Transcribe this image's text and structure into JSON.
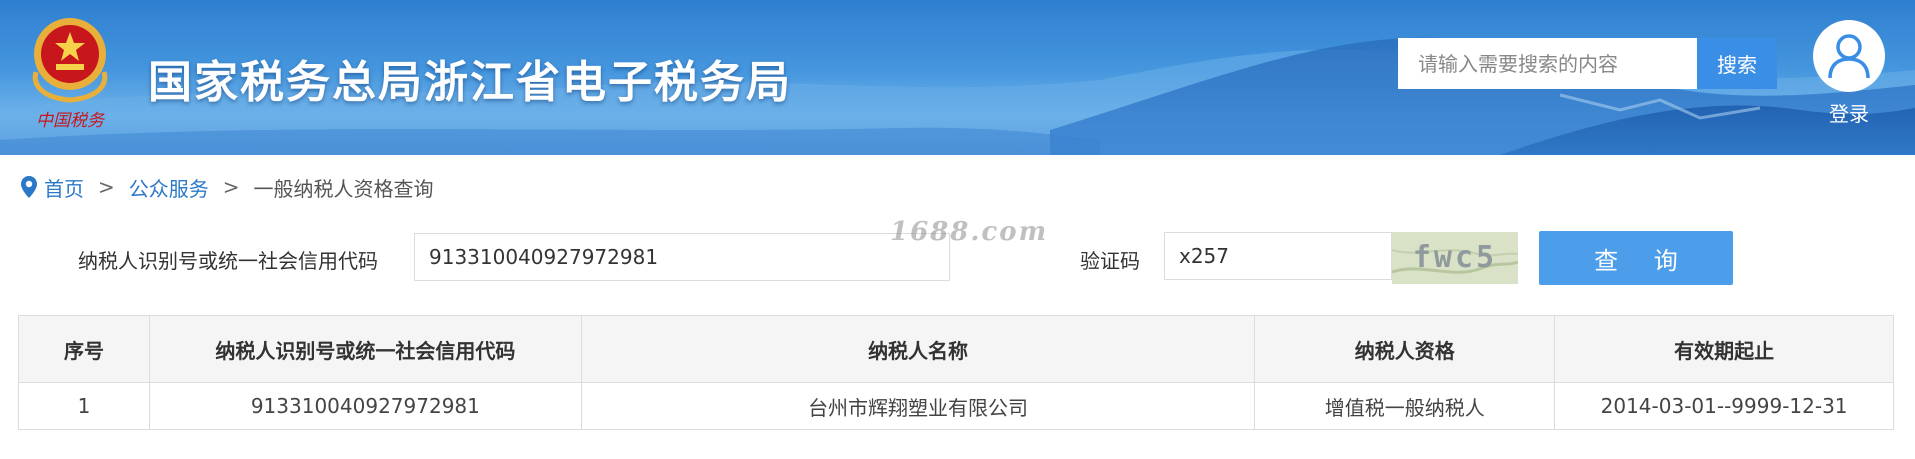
{
  "header": {
    "site_title": "国家税务总局浙江省电子税务局",
    "emblem_text": "中国税务",
    "search": {
      "placeholder": "请输入需要搜索的内容",
      "button_label": "搜索"
    },
    "login_label": "登录"
  },
  "breadcrumb": {
    "items": [
      "首页",
      "公众服务",
      "一般纳税人资格查询"
    ],
    "separator": ">"
  },
  "form": {
    "taxpayer_id_label": "纳税人识别号或统一社会信用代码",
    "taxpayer_id_value": "913310040927972981",
    "captcha_label": "验证码",
    "captcha_value": "x257",
    "captcha_image_text": "fwc5",
    "query_button_label": "查 询",
    "watermark": "1688.com"
  },
  "table": {
    "headers": [
      "序号",
      "纳税人识别号或统一社会信用代码",
      "纳税人名称",
      "纳税人资格",
      "有效期起止"
    ],
    "rows": [
      [
        "1",
        "913310040927972981",
        "台州市辉翔塑业有限公司",
        "增值税一般纳税人",
        "2014-03-01--9999-12-31"
      ]
    ]
  },
  "colors": {
    "banner_blue": "#3f8fdb",
    "search_button": "#3b8ee6",
    "query_button": "#4d9eea",
    "link_blue": "#2b78c8",
    "emblem_red": "#c8161d",
    "emblem_gold": "#e8b03a"
  }
}
